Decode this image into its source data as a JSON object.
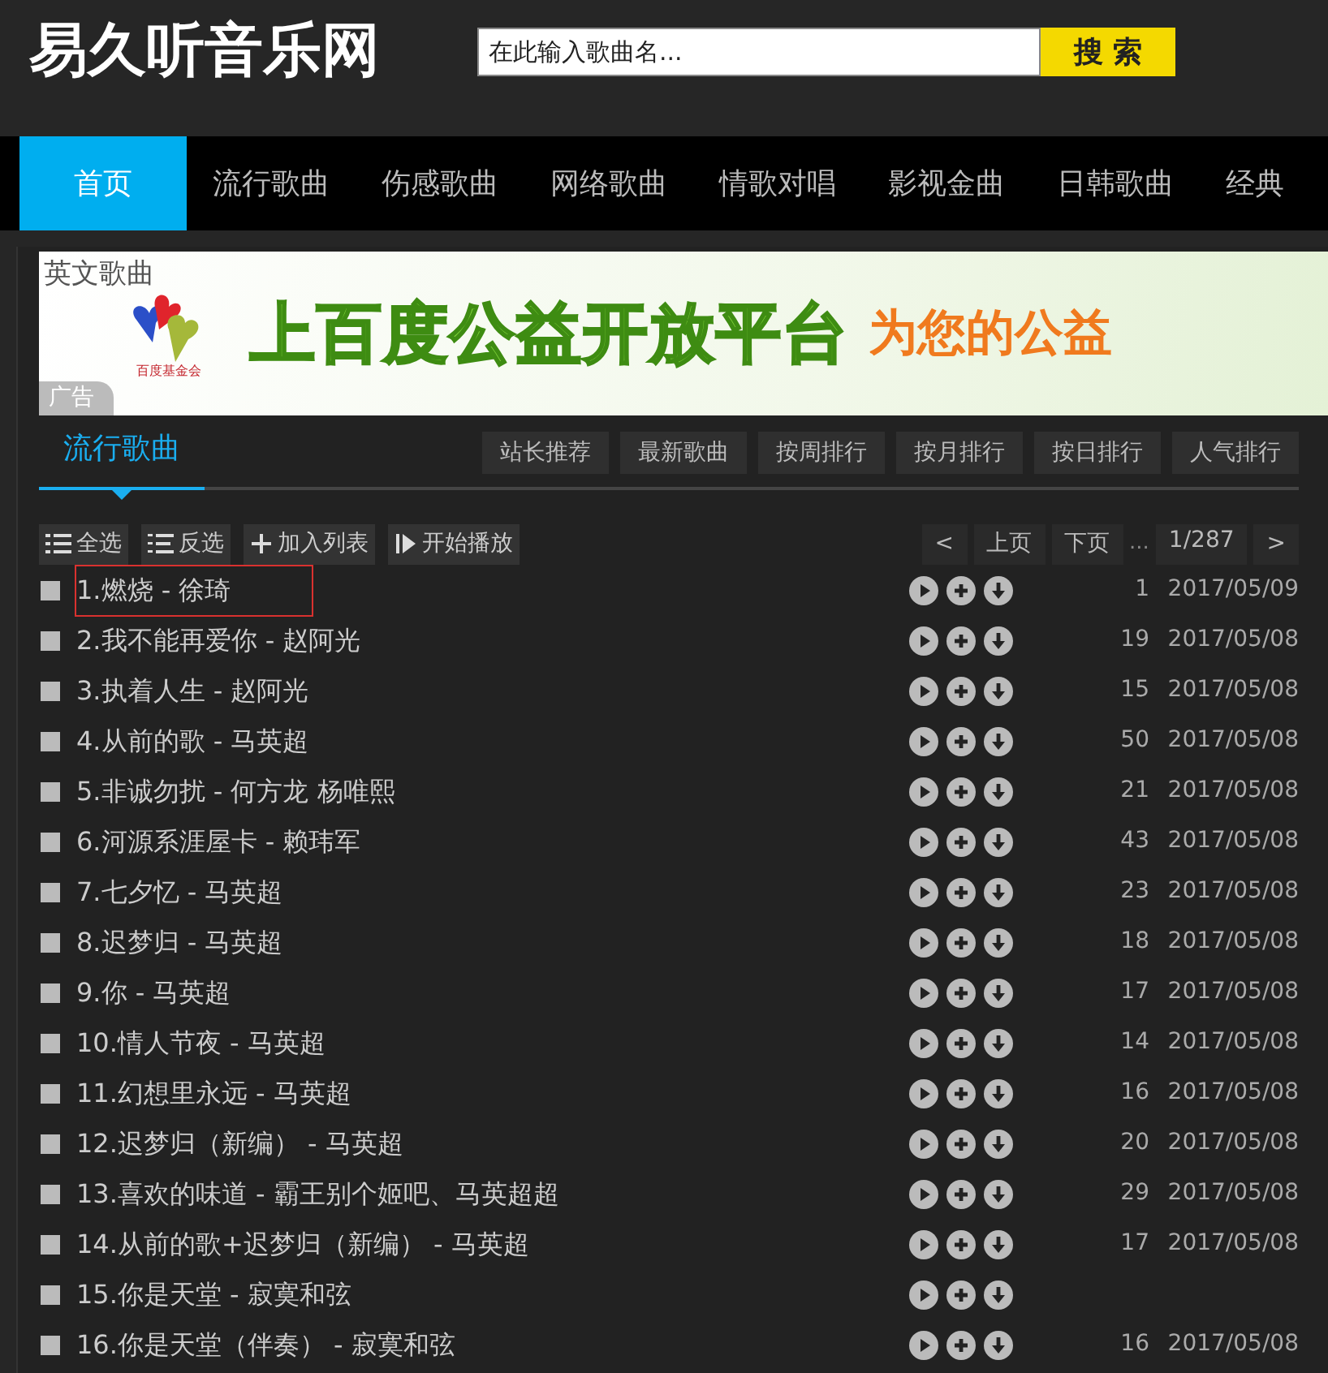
{
  "header": {
    "logo": "易久听音乐网",
    "search": {
      "placeholder": "在此输入歌曲名..."
    },
    "search_button": "搜 索"
  },
  "nav": [
    {
      "label": "首页",
      "selected": true
    },
    {
      "label": "流行歌曲",
      "selected": false
    },
    {
      "label": "伤感歌曲",
      "selected": false
    },
    {
      "label": "网络歌曲",
      "selected": false
    },
    {
      "label": "情歌对唱",
      "selected": false
    },
    {
      "label": "影视金曲",
      "selected": false
    },
    {
      "label": "日韩歌曲",
      "selected": false
    },
    {
      "label": "经典",
      "selected": false
    }
  ],
  "ad": {
    "title": "英文歌曲",
    "logo_text": "百度基金会",
    "headline": "上百度公益开放平台",
    "tagline": "为您的公益",
    "label": "广告"
  },
  "section": {
    "title": "流行歌曲",
    "filters": [
      "站长推荐",
      "最新歌曲",
      "按周排行",
      "按月排行",
      "按日排行",
      "人气排行"
    ]
  },
  "toolbar": [
    {
      "label": "全选",
      "kind": "all"
    },
    {
      "label": "反选",
      "kind": "invert"
    },
    {
      "label": "加入列表",
      "kind": "add"
    },
    {
      "label": "开始播放",
      "kind": "play"
    }
  ],
  "pager": {
    "prev": "<",
    "prev_page": "上页",
    "next_page": "下页",
    "ellipsis": "...",
    "page": "1/287",
    "next": ">"
  },
  "songs": [
    {
      "title": "1.燃烧 - 徐琦",
      "plays": "1",
      "date": "2017/05/09",
      "checked": false,
      "highlighted": true
    },
    {
      "title": "2.我不能再爱你 - 赵阿光",
      "plays": "19",
      "date": "2017/05/08",
      "checked": false,
      "highlighted": false
    },
    {
      "title": "3.执着人生 - 赵阿光",
      "plays": "15",
      "date": "2017/05/08",
      "checked": false,
      "highlighted": false
    },
    {
      "title": "4.从前的歌 - 马英超",
      "plays": "50",
      "date": "2017/05/08",
      "checked": false,
      "highlighted": false
    },
    {
      "title": "5.非诚勿扰 - 何方龙 杨唯熙",
      "plays": "21",
      "date": "2017/05/08",
      "checked": false,
      "highlighted": false
    },
    {
      "title": "6.河源系涯屋卡 - 赖玮军",
      "plays": "43",
      "date": "2017/05/08",
      "checked": false,
      "highlighted": false
    },
    {
      "title": "7.七夕忆 - 马英超",
      "plays": "23",
      "date": "2017/05/08",
      "checked": false,
      "highlighted": false
    },
    {
      "title": "8.迟梦归 - 马英超",
      "plays": "18",
      "date": "2017/05/08",
      "checked": false,
      "highlighted": false
    },
    {
      "title": "9.你 - 马英超",
      "plays": "17",
      "date": "2017/05/08",
      "checked": false,
      "highlighted": false
    },
    {
      "title": "10.情人节夜 - 马英超",
      "plays": "14",
      "date": "2017/05/08",
      "checked": false,
      "highlighted": false
    },
    {
      "title": "11.幻想里永远 - 马英超",
      "plays": "16",
      "date": "2017/05/08",
      "checked": false,
      "highlighted": false
    },
    {
      "title": "12.迟梦归（新编） - 马英超",
      "plays": "20",
      "date": "2017/05/08",
      "checked": false,
      "highlighted": false
    },
    {
      "title": "13.喜欢的味道 - 霸王别个姬吧、马英超超",
      "plays": "29",
      "date": "2017/05/08",
      "checked": false,
      "highlighted": false
    },
    {
      "title": "14.从前的歌+迟梦归（新编） - 马英超",
      "plays": "17",
      "date": "2017/05/08",
      "checked": false,
      "highlighted": false
    },
    {
      "title": "15.你是天堂 - 寂寞和弦",
      "checked": false,
      "highlighted": false
    },
    {
      "title": "16.你是天堂（伴奏） - 寂寞和弦",
      "plays": "16",
      "date": "2017/05/08",
      "checked": false,
      "highlighted": false
    }
  ]
}
